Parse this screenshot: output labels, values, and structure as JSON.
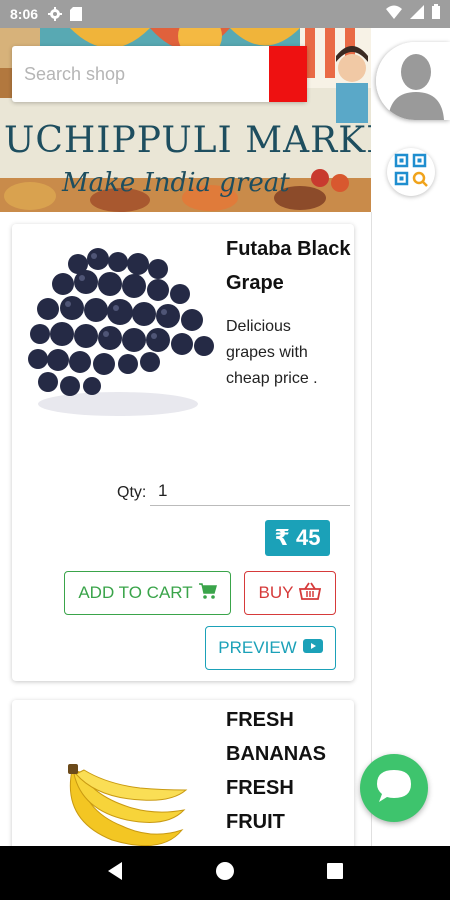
{
  "status_bar": {
    "time": "8:06",
    "icons": [
      "settings-icon",
      "sd-card-icon",
      "wifi-icon",
      "signal-icon",
      "battery-icon"
    ]
  },
  "header": {
    "search": {
      "placeholder": "Search shop",
      "value": ""
    },
    "search_icon": "search-icon",
    "banner_title": "UCHIPPULI MARKET",
    "banner_slogan": "Make India great",
    "accent_color": "#ee1111"
  },
  "sidebar": {
    "avatar_icon": "user-avatar-icon",
    "qr_icon": "qr-scan-icon"
  },
  "products": [
    {
      "title": "Futaba Black Grape",
      "description": "Delicious grapes with cheap price .",
      "qty_label": "Qty:",
      "qty_value": "1",
      "price": "₹ 45",
      "add_to_cart_label": "ADD TO CART",
      "buy_label": "BUY",
      "preview_label": "PREVIEW"
    },
    {
      "title": "FRESH BANANAS FRESH FRUIT"
    }
  ],
  "colors": {
    "cart_green": "#3aa44a",
    "buy_red": "#d63a3a",
    "preview_teal": "#1ba1b8",
    "chat_green": "#3ec46d"
  },
  "chat_icon": "chat-bubble-icon",
  "nav": [
    "back-icon",
    "home-icon",
    "recents-icon"
  ]
}
